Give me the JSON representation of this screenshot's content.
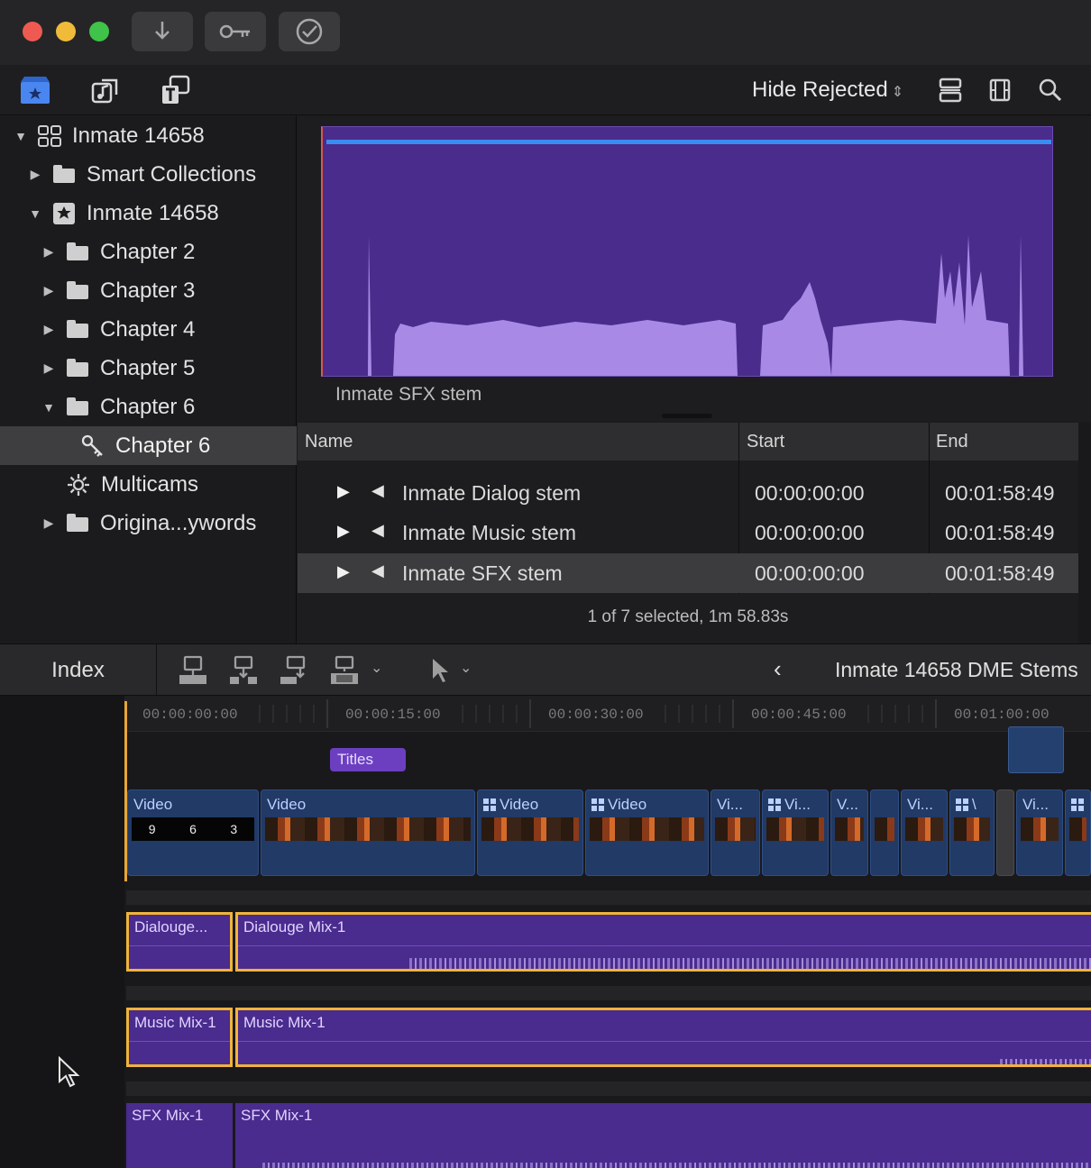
{
  "titlebar": {
    "buttons": [
      "import-icon",
      "key-icon",
      "checkmark-icon"
    ]
  },
  "toolbar": {
    "icons": [
      "libraries-icon",
      "photos-audio-icon",
      "titles-generators-icon"
    ],
    "filter_label": "Hide Rejected",
    "right_icons": [
      "clip-appearance-icon",
      "filmstrip-icon",
      "search-icon"
    ],
    "colors": {
      "libraries_icon": "#4a86f0"
    }
  },
  "sidebar": {
    "items": [
      {
        "label": "Inmate 14658",
        "expanded": true,
        "icon": "library-icon"
      },
      {
        "label": "Smart Collections",
        "expanded": false,
        "icon": "folder-icon"
      },
      {
        "label": "Inmate 14658",
        "expanded": true,
        "icon": "event-icon"
      },
      {
        "label": "Chapter 2",
        "expanded": false,
        "icon": "folder-icon"
      },
      {
        "label": "Chapter 3",
        "expanded": false,
        "icon": "folder-icon"
      },
      {
        "label": "Chapter 4",
        "expanded": false,
        "icon": "folder-icon"
      },
      {
        "label": "Chapter 5",
        "expanded": false,
        "icon": "folder-icon"
      },
      {
        "label": "Chapter 6",
        "expanded": true,
        "icon": "folder-icon"
      },
      {
        "label": "Chapter 6",
        "selected": true,
        "icon": "keyword-icon"
      },
      {
        "label": "Multicams",
        "icon": "gear-icon"
      },
      {
        "label": "Origina...ywords",
        "expanded": false,
        "icon": "folder-icon"
      }
    ]
  },
  "viewer": {
    "clip_name": "Inmate SFX stem",
    "colors": {
      "waveform_bg": "#4a2c8c",
      "waveform_fill": "#a88ae6",
      "level_line": "#3a8df0"
    }
  },
  "list": {
    "columns": [
      "Name",
      "Start",
      "End"
    ],
    "rows": [
      {
        "name": "Inmate Dialog stem",
        "start": "00:00:00:00",
        "end": "00:01:58:49"
      },
      {
        "name": "Inmate Music stem",
        "start": "00:00:00:00",
        "end": "00:01:58:49"
      },
      {
        "name": "Inmate SFX stem",
        "start": "00:00:00:00",
        "end": "00:01:58:49",
        "selected": true
      }
    ],
    "status": "1 of 7 selected, 1m 58.83s"
  },
  "timeline_toolbar": {
    "index_label": "Index",
    "project_title": "Inmate 14658 DME Stems",
    "edit_tools": [
      "connect-clip-icon",
      "insert-clip-icon",
      "append-clip-icon",
      "overwrite-clip-icon"
    ],
    "select_tool": "arrow-tool-icon"
  },
  "timeline": {
    "ruler": [
      "00:00:00:00",
      "00:00:15:00",
      "00:00:30:00",
      "00:00:45:00",
      "00:01:00:00"
    ],
    "title_clip": "Titles",
    "video_clips": [
      {
        "label": "Video",
        "countdown": [
          "9",
          "6",
          "3"
        ]
      },
      {
        "label": "Video"
      },
      {
        "label": "Video",
        "multicam": true
      },
      {
        "label": "Video",
        "multicam": true
      },
      {
        "label": "Vi..."
      },
      {
        "label": "Vi...",
        "multicam": true
      },
      {
        "label": "V..."
      },
      {
        "label": ""
      },
      {
        "label": "Vi..."
      },
      {
        "label": "\\",
        "multicam": true
      },
      {
        "label": ""
      },
      {
        "label": "Vi..."
      },
      {
        "label": "",
        "multicam": true
      }
    ],
    "audio_lanes": [
      {
        "clips": [
          "Dialouge...",
          "Dialouge Mix-1"
        ],
        "selected": true
      },
      {
        "clips": [
          "Music Mix-1",
          "Music Mix-1"
        ],
        "selected": true
      },
      {
        "clips": [
          "SFX Mix-1",
          "SFX Mix-1"
        ],
        "selected": false
      }
    ],
    "colors": {
      "audio": "#4a2b8e",
      "video": "#213a66",
      "selection": "#f0b43a",
      "title": "#6c3fc0"
    }
  }
}
